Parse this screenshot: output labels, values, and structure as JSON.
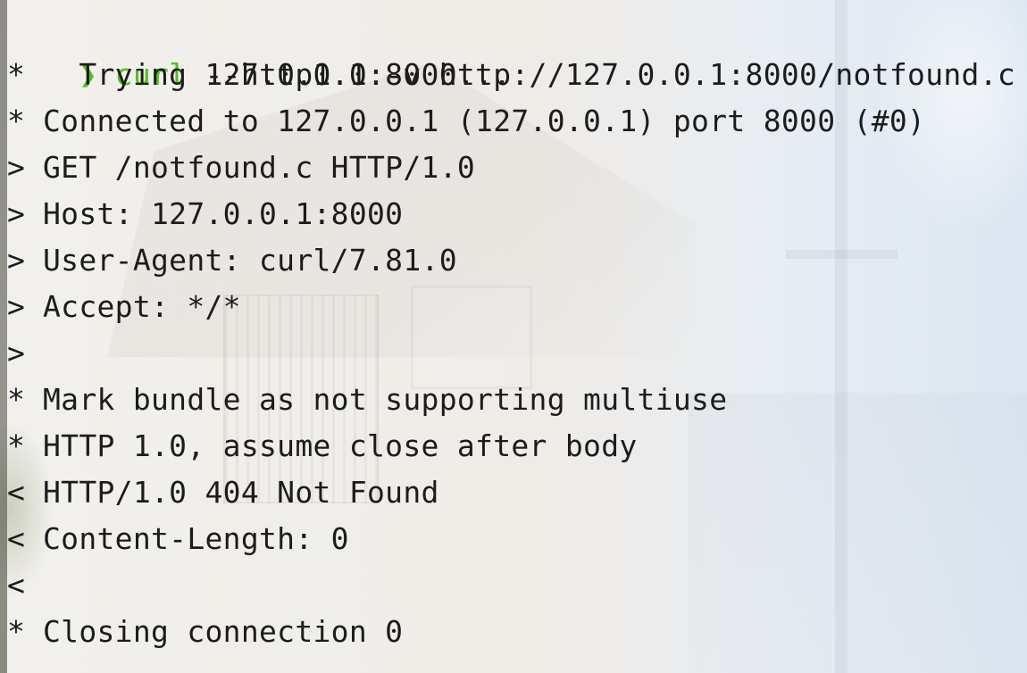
{
  "prompt": {
    "symbol": "❯",
    "command": "curl",
    "args": " --http1.0 -v http://127.0.0.1:8000/notfound.c"
  },
  "output": [
    {
      "prefix": "*",
      "text": "  Trying 127.0.0.1:8000..."
    },
    {
      "prefix": "*",
      "text": "Connected to 127.0.0.1 (127.0.0.1) port 8000 (#0)"
    },
    {
      "prefix": ">",
      "text": "GET /notfound.c HTTP/1.0"
    },
    {
      "prefix": ">",
      "text": "Host: 127.0.0.1:8000"
    },
    {
      "prefix": ">",
      "text": "User-Agent: curl/7.81.0"
    },
    {
      "prefix": ">",
      "text": "Accept: */*"
    },
    {
      "prefix": ">",
      "text": ""
    },
    {
      "prefix": "*",
      "text": "Mark bundle as not supporting multiuse"
    },
    {
      "prefix": "*",
      "text": "HTTP 1.0, assume close after body"
    },
    {
      "prefix": "<",
      "text": "HTTP/1.0 404 Not Found"
    },
    {
      "prefix": "<",
      "text": "Content-Length: 0"
    },
    {
      "prefix": "<",
      "text": ""
    },
    {
      "prefix": "*",
      "text": "Closing connection 0"
    }
  ],
  "colors": {
    "prompt_green": "#4cc31a",
    "text": "#1c1c1c"
  }
}
